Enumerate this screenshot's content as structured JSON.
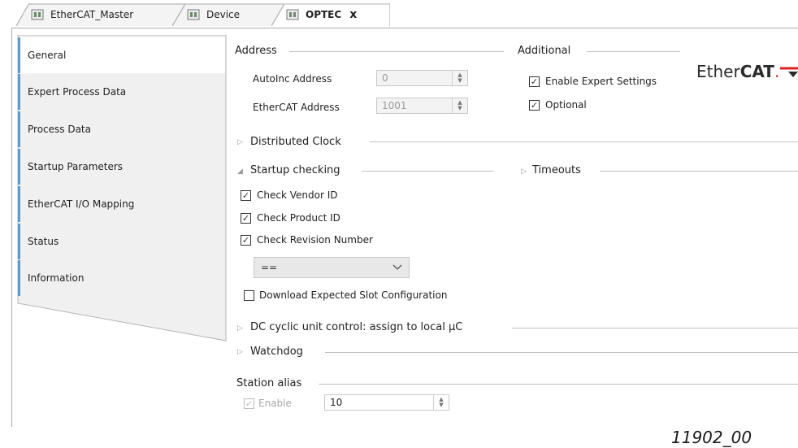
{
  "tabs": [
    {
      "label": "EtherCAT_Master",
      "active": false
    },
    {
      "label": "Device",
      "active": false
    },
    {
      "label": "OPTEC",
      "active": true,
      "close": "x"
    }
  ],
  "nav": {
    "items": [
      {
        "label": "General",
        "active": true
      },
      {
        "label": "Expert Process Data"
      },
      {
        "label": "Process Data"
      },
      {
        "label": "Startup Parameters"
      },
      {
        "label": "EtherCAT I/O Mapping"
      },
      {
        "label": "Status"
      },
      {
        "label": "Information"
      }
    ]
  },
  "address": {
    "title": "Address",
    "autoinc_label": "AutoInc Address",
    "autoinc_value": "0",
    "ethercat_label": "EtherCAT Address",
    "ethercat_value": "1001"
  },
  "additional": {
    "title": "Additional",
    "enable_expert": {
      "label": "Enable Expert Settings",
      "checked": true
    },
    "optional": {
      "label": "Optional",
      "checked": true
    }
  },
  "logo": {
    "prefix": "Ether",
    "bold": "CAT",
    "suffix": "."
  },
  "distributed_clock": {
    "title": "Distributed Clock",
    "expanded": false
  },
  "startup_checking": {
    "title": "Startup checking",
    "expanded": true,
    "checks": [
      {
        "label": "Check Vendor ID",
        "checked": true
      },
      {
        "label": "Check Product ID",
        "checked": true
      },
      {
        "label": "Check Revision Number",
        "checked": true
      }
    ],
    "comparison_value": "==",
    "download_slot": {
      "label": "Download Expected Slot Configuration",
      "checked": false
    }
  },
  "timeouts": {
    "title": "Timeouts",
    "expanded": false
  },
  "dc_cyclic": {
    "title": "DC cyclic unit control: assign to local µC",
    "expanded": false
  },
  "watchdog": {
    "title": "Watchdog",
    "expanded": false
  },
  "station_alias": {
    "title": "Station alias",
    "enable": {
      "label": "Enable",
      "checked": true,
      "disabled": true
    },
    "value": "10"
  },
  "caption": "11902_00",
  "colors": {
    "accent": "#5b9bd5",
    "nav_bg": "#f0f0f0",
    "logo_red": "#dd2222"
  }
}
